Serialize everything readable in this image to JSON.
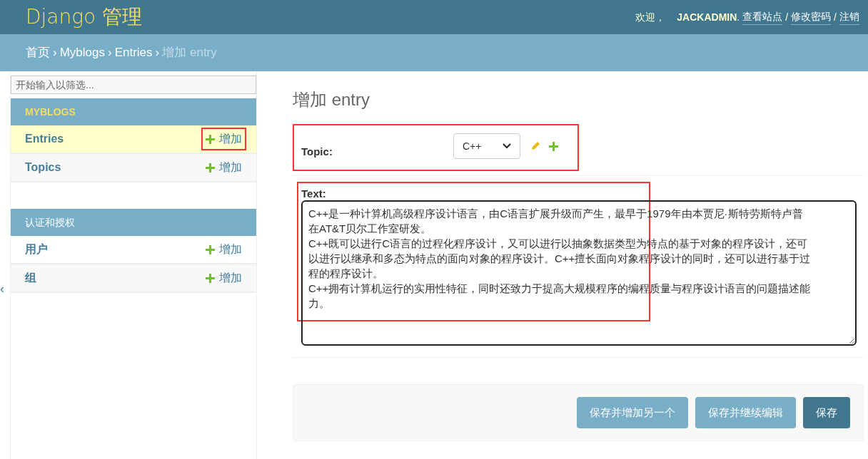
{
  "header": {
    "brand": "Django 管理",
    "welcome": "欢迎，",
    "user": "JACKADMIN",
    "period": ".",
    "separator": "/",
    "user_links": [
      {
        "label": "查看站点"
      },
      {
        "label": "修改密码"
      },
      {
        "label": "注销"
      }
    ]
  },
  "breadcrumb_separator": "›",
  "breadcrumbs": [
    {
      "label": "首页",
      "current": false
    },
    {
      "label": "Myblogs",
      "current": false
    },
    {
      "label": "Entries",
      "current": false
    },
    {
      "label": "增加 entry",
      "current": true
    }
  ],
  "sidebar": {
    "filter": {
      "placeholder": "开始输入以筛选..."
    },
    "toggle": "‹",
    "apps": [
      {
        "name": "MYBLOGS",
        "selected": true,
        "models": [
          {
            "name": "Entries",
            "add": "增加",
            "selected": true,
            "highlighted": true
          },
          {
            "name": "Topics",
            "add": "增加",
            "selected": false,
            "highlighted": false
          }
        ]
      },
      {
        "name": "认证和授权",
        "selected": false,
        "models": [
          {
            "name": "用户",
            "add": "增加",
            "selected": false,
            "highlighted": false
          },
          {
            "name": "组",
            "add": "增加",
            "selected": false,
            "highlighted": false
          }
        ]
      }
    ]
  },
  "form": {
    "title": "增加 entry",
    "topic": {
      "label": "Topic:",
      "value": "C++",
      "highlighted": true
    },
    "text": {
      "label": "Text:",
      "highlighted": true,
      "value": "C++是一种计算机高级程序设计语言，由C语言扩展升级而产生，最早于1979年由本贾尼·斯特劳斯特卢普在AT&T贝尔工作室研发。\nC++既可以进行C语言的过程化程序设计，又可以进行以抽象数据类型为特点的基于对象的程序设计，还可以进行以继承和多态为特点的面向对象的程序设计。C++擅长面向对象程序设计的同时，还可以进行基于过程的程序设计。\nC++拥有计算机运行的实用性特征，同时还致力于提高大规模程序的编程质量与程序设计语言的问题描述能力。"
    },
    "buttons": [
      {
        "label": "保存并增加另一个",
        "kind": "secondary"
      },
      {
        "label": "保存并继续编辑",
        "kind": "secondary"
      },
      {
        "label": "保存",
        "kind": "primary"
      }
    ]
  }
}
